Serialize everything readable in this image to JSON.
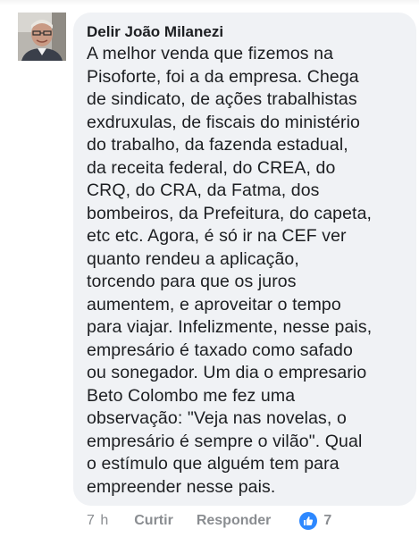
{
  "comment": {
    "author": "Delir João Milanezi",
    "text": "A melhor venda que fizemos na\nPisoforte, foi a da empresa. Chega\nde sindicato, de ações trabalhistas\nexdruxulas,  de fiscais do ministério\ndo trabalho, da fazenda estadual,\nda receita federal, do CREA, do\nCRQ, do CRA, da Fatma, dos\nbombeiros, da Prefeitura, do capeta,\netc etc. Agora, é só ir na CEF ver\nquanto rendeu a aplicação,\ntorcendo para que os juros\naumentem, e aproveitar o tempo\npara viajar. Infelizmente, nesse pais,\nempresário é taxado como safado\nou sonegador. Um dia o empresario\nBeto Colombo me fez uma\nobservação: \"Veja nas novelas, o\nempresário é sempre o vilão\".  Qual\no estímulo que alguém tem para\nempreender nesse pais.",
    "avatar_icon": "user-avatar-photo"
  },
  "actions": {
    "time": "7 h",
    "like_label": "Curtir",
    "reply_label": "Responder",
    "reaction_icon": "like-icon",
    "reaction_count": "7"
  },
  "colors": {
    "bubble": "#f0f2f5",
    "text": "#1c1e21",
    "meta": "#8a8d91",
    "like_blue": "#2d88ff"
  }
}
